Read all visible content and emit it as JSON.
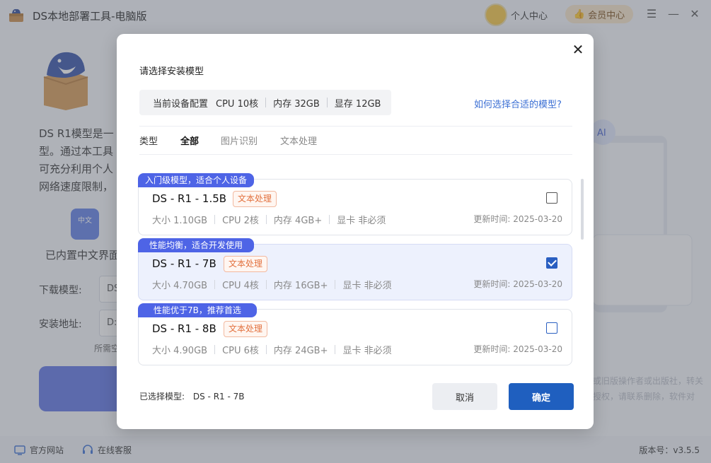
{
  "app": {
    "title": "DS本地部署工具-电脑版",
    "user_center": "个人中心",
    "vip_center": "会员中心"
  },
  "background": {
    "desc": "DS R1模型是一\n型。通过本工具\n可充分利用个人\n网络速度限制，",
    "zh_icon_text": "中文",
    "zh_label": "已内置中文界面",
    "download_label": "下载模型:",
    "download_value": "DS",
    "install_label": "安装地址:",
    "install_value": "D:",
    "need_space": "所需空间",
    "right_text_1": "或旧版操作者或出版社，转关",
    "right_text_2": "授权，请联系删除，软件对"
  },
  "footer": {
    "website": "官方网站",
    "support": "在线客服",
    "version": "版本号：v3.5.5"
  },
  "dialog": {
    "title": "请选择安装模型",
    "config": {
      "label": "当前设备配置",
      "cpu": "CPU 10核",
      "memory": "内存 32GB",
      "vram": "显存 12GB"
    },
    "help_link": "如何选择合适的模型?",
    "tabs": {
      "label": "类型",
      "items": [
        "全部",
        "图片识别",
        "文本处理"
      ],
      "active": "全部"
    },
    "models": [
      {
        "tag": "入门级模型，适合个人设备",
        "name": "DS - R1 - 1.5B",
        "badge": "文本处理",
        "size": "大小 1.10GB",
        "cpu": "CPU 2核",
        "memory": "内存 4GB+",
        "gpu": "显卡 非必须",
        "updated": "更新时间:  2025-03-20",
        "selected": false
      },
      {
        "tag": "性能均衡，适合开发使用",
        "name": "DS - R1 - 7B",
        "badge": "文本处理",
        "size": "大小 4.70GB",
        "cpu": "CPU 4核",
        "memory": "内存 16GB+",
        "gpu": "显卡 非必须",
        "updated": "更新时间:  2025-03-20",
        "selected": true
      },
      {
        "tag": "性能优于7B，推荐首选",
        "name": "DS - R1 - 8B",
        "badge": "文本处理",
        "size": "大小 4.90GB",
        "cpu": "CPU 6核",
        "memory": "内存 24GB+",
        "gpu": "显卡 非必须",
        "updated": "更新时间:  2025-03-20",
        "selected": false
      }
    ],
    "selected_label": "已选择模型:",
    "selected_value": "DS - R1 - 7B",
    "cancel": "取消",
    "confirm": "确定"
  },
  "colors": {
    "accent": "#1f5fbf",
    "tag": "#4e64e6",
    "badge_text": "#e2703d",
    "link": "#3b6fd4"
  },
  "icons": {
    "app_logo": "toolbox-icon",
    "avatar": "user-avatar-icon",
    "vip": "thumbs-up-icon",
    "menu": "menu-icon",
    "minimize": "minimize-icon",
    "close": "close-icon",
    "website": "website-icon",
    "support": "headset-icon"
  }
}
